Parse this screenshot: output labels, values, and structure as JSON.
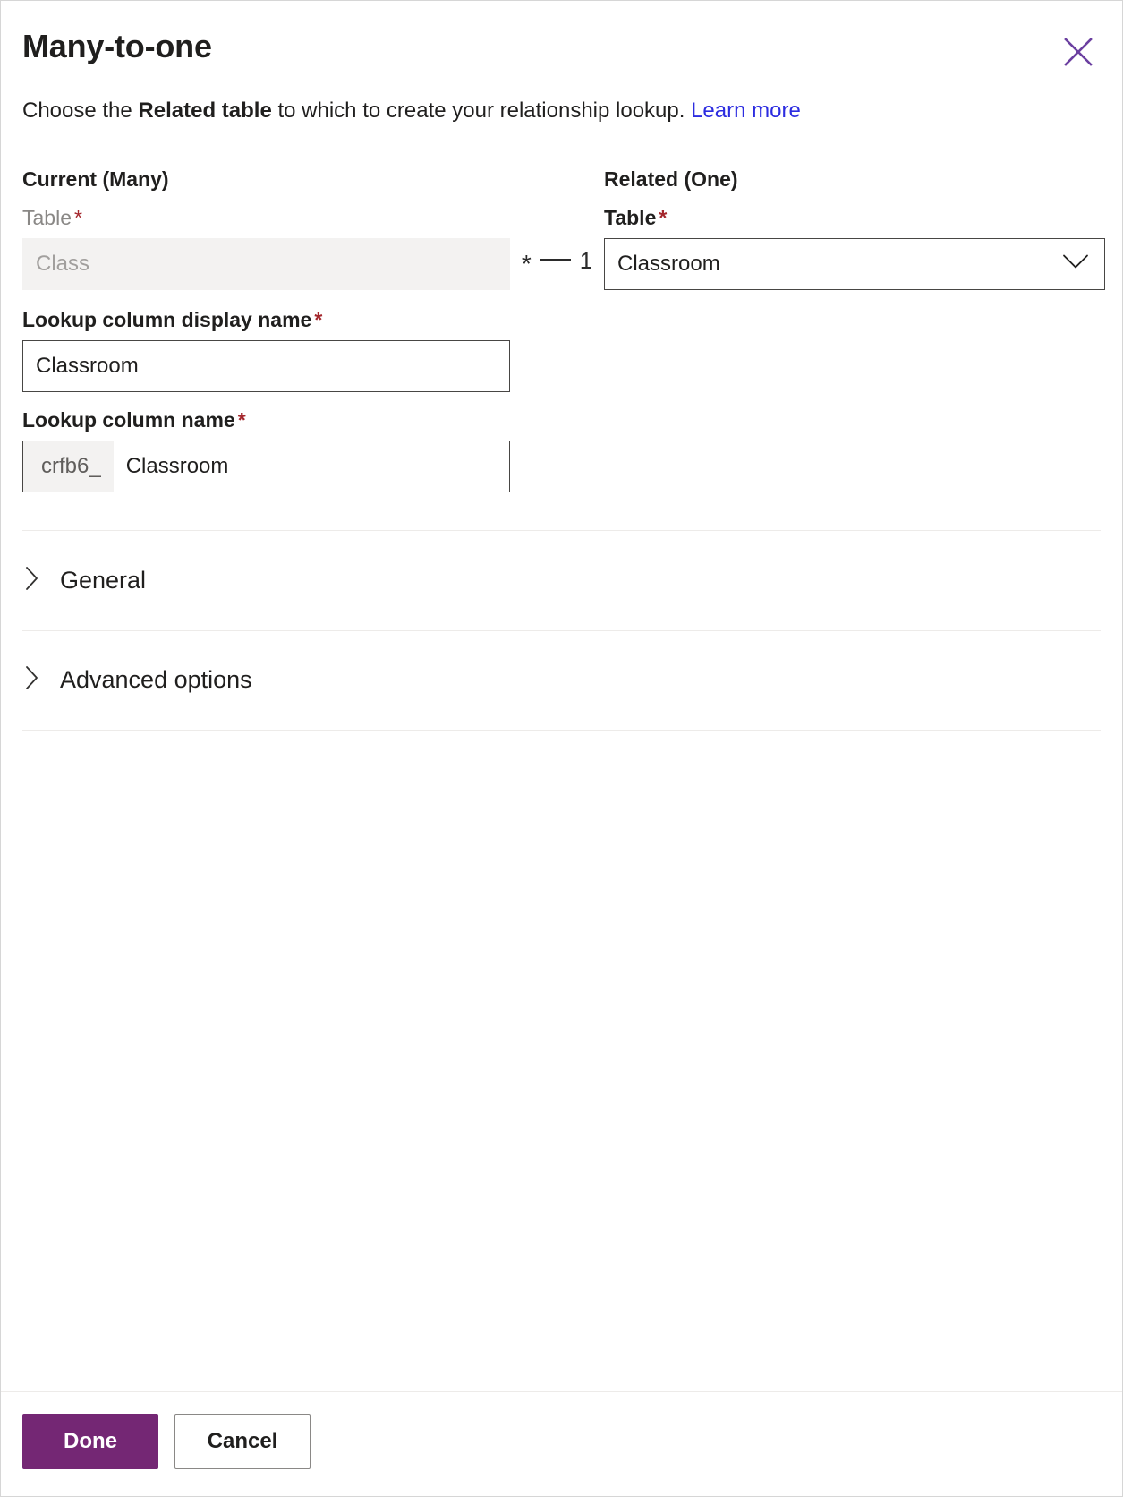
{
  "dialog": {
    "title": "Many-to-one",
    "close_icon": "close-icon",
    "subtitle": {
      "before": "Choose the ",
      "strong": "Related table",
      "after": " to which to create your relationship lookup. ",
      "link": "Learn more"
    }
  },
  "current": {
    "heading": "Current (Many)",
    "table_label": "Table",
    "required_mark": "*",
    "table_value": "Class",
    "table_placeholder": "Class"
  },
  "cardinality": {
    "many": "*",
    "dash": "—",
    "one": "1"
  },
  "related": {
    "heading": "Related (One)",
    "table_label": "Table",
    "required_mark": "*",
    "table_value": "Classroom",
    "dropdown_icon": "chevron-down-icon"
  },
  "lookup_display_name": {
    "label": "Lookup column display name",
    "required_mark": "*",
    "value": "Classroom"
  },
  "lookup_name": {
    "label": "Lookup column name",
    "required_mark": "*",
    "prefix": "crfb6_",
    "value": "Classroom"
  },
  "accordions": [
    {
      "label": "General",
      "icon": "chevron-right-icon",
      "expanded": false
    },
    {
      "label": "Advanced options",
      "icon": "chevron-right-icon",
      "expanded": false
    }
  ],
  "footer": {
    "done_label": "Done",
    "cancel_label": "Cancel"
  },
  "colors": {
    "accent": "#742774",
    "close_icon": "#6b3fa0",
    "link": "#2c2ce0",
    "required": "#a4262c",
    "border": "#484644",
    "disabled_bg": "#f3f2f1"
  }
}
